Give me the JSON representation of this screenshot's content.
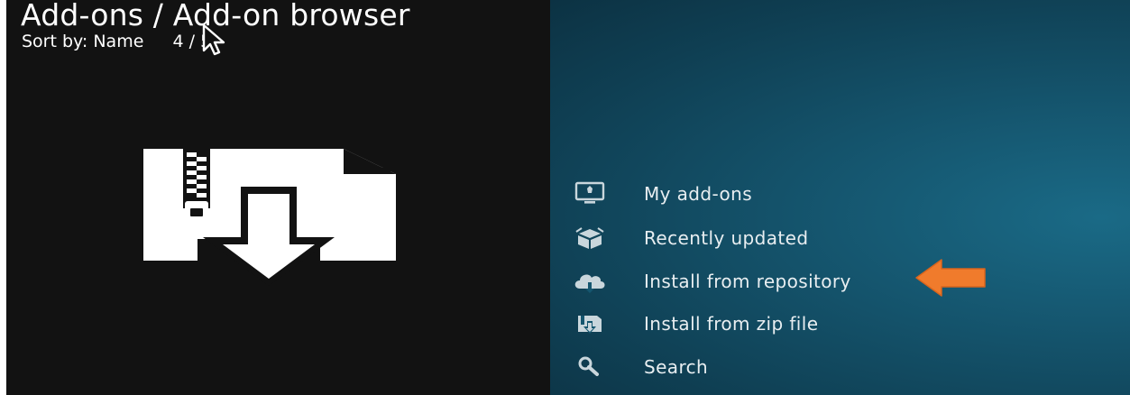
{
  "header": {
    "title": "Add-ons / Add-on browser",
    "sort_label": "Sort by: Name",
    "position": "4 / 5"
  },
  "menu": {
    "items": [
      {
        "label": "My add-ons",
        "icon": "monitor-icon"
      },
      {
        "label": "Recently updated",
        "icon": "open-box-icon"
      },
      {
        "label": "Install from repository",
        "icon": "cloud-download-icon"
      },
      {
        "label": "Install from zip file",
        "icon": "zip-file-icon"
      },
      {
        "label": "Search",
        "icon": "search-icon"
      }
    ]
  },
  "colors": {
    "left_background": "#121212",
    "right_background": "#15566f",
    "text": "#ffffff",
    "annotation_arrow": "#f07b2c"
  }
}
